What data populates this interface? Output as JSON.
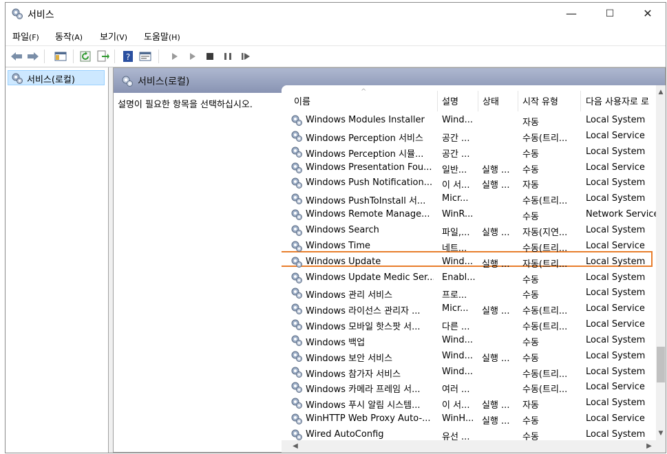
{
  "window": {
    "title": "서비스",
    "minimize": "—",
    "maximize": "☐",
    "close": "✕"
  },
  "menu": [
    {
      "label": "파일",
      "accel": "(F)"
    },
    {
      "label": "동작",
      "accel": "(A)"
    },
    {
      "label": "보기",
      "accel": "(V)"
    },
    {
      "label": "도움말",
      "accel": "(H)"
    }
  ],
  "tree": {
    "item": "서비스(로컬)"
  },
  "pane": {
    "header": "서비스(로컬)",
    "description": "설명이 필요한 항목을 선택하십시오."
  },
  "columns": {
    "name": "이름",
    "desc": "설명",
    "status": "상태",
    "startup": "시작 유형",
    "logon": "다음 사용자로 로"
  },
  "rows": [
    {
      "name": "Windows Modules Installer",
      "desc": "Wind...",
      "status": "",
      "startup": "자동",
      "logon": "Local System"
    },
    {
      "name": "Windows Perception 서비스",
      "desc": "공간 ...",
      "status": "",
      "startup": "수동(트리...",
      "logon": "Local Service"
    },
    {
      "name": "Windows Perception 시뮬...",
      "desc": "공간 ...",
      "status": "",
      "startup": "수동",
      "logon": "Local System"
    },
    {
      "name": "Windows Presentation Fou...",
      "desc": "일반...",
      "status": "실행 ...",
      "startup": "수동",
      "logon": "Local Service"
    },
    {
      "name": "Windows Push Notification...",
      "desc": "이 서...",
      "status": "실행 ...",
      "startup": "자동",
      "logon": "Local System"
    },
    {
      "name": "Windows PushToInstall 서...",
      "desc": "Micr...",
      "status": "",
      "startup": "수동(트리...",
      "logon": "Local System"
    },
    {
      "name": "Windows Remote Manage...",
      "desc": "WinR...",
      "status": "",
      "startup": "수동",
      "logon": "Network Service"
    },
    {
      "name": "Windows Search",
      "desc": "파일,...",
      "status": "실행 ...",
      "startup": "자동(지연...",
      "logon": "Local System"
    },
    {
      "name": "Windows Time",
      "desc": "네트...",
      "status": "",
      "startup": "수동(트리...",
      "logon": "Local Service"
    },
    {
      "name": "Windows Update",
      "desc": "Wind...",
      "status": "실행 ...",
      "startup": "자동(트리...",
      "logon": "Local System"
    },
    {
      "name": "Windows Update Medic Ser...",
      "desc": "Enabl...",
      "status": "",
      "startup": "수동",
      "logon": "Local System"
    },
    {
      "name": "Windows 관리 서비스",
      "desc": "프로...",
      "status": "",
      "startup": "수동",
      "logon": "Local System"
    },
    {
      "name": "Windows 라이선스 관리자 ...",
      "desc": "Micr...",
      "status": "실행 ...",
      "startup": "수동(트리...",
      "logon": "Local Service"
    },
    {
      "name": "Windows 모바일 핫스팟 서...",
      "desc": "다른 ...",
      "status": "",
      "startup": "수동(트리...",
      "logon": "Local Service"
    },
    {
      "name": "Windows 백업",
      "desc": "Wind...",
      "status": "",
      "startup": "수동",
      "logon": "Local System"
    },
    {
      "name": "Windows 보안 서비스",
      "desc": "Wind...",
      "status": "실행 ...",
      "startup": "수동",
      "logon": "Local System"
    },
    {
      "name": "Windows 참가자 서비스",
      "desc": "Wind...",
      "status": "",
      "startup": "수동(트리...",
      "logon": "Local System"
    },
    {
      "name": "Windows 카메라 프레임 서...",
      "desc": "여러 ...",
      "status": "",
      "startup": "수동(트리...",
      "logon": "Local Service"
    },
    {
      "name": "Windows 푸시 알림 시스템...",
      "desc": "이 서...",
      "status": "실행 ...",
      "startup": "자동",
      "logon": "Local System"
    },
    {
      "name": "WinHTTP Web Proxy Auto-...",
      "desc": "WinH...",
      "status": "실행 ...",
      "startup": "수동",
      "logon": "Local Service"
    },
    {
      "name": "Wired AutoConfig",
      "desc": "유선 ...",
      "status": "",
      "startup": "수동",
      "logon": "Local System"
    }
  ],
  "highlighted_row": "Windows Update",
  "colors": {
    "highlight_border": "#e87d2b",
    "tree_selection": "#cde8ff",
    "pane_header": "#8f99b8"
  }
}
